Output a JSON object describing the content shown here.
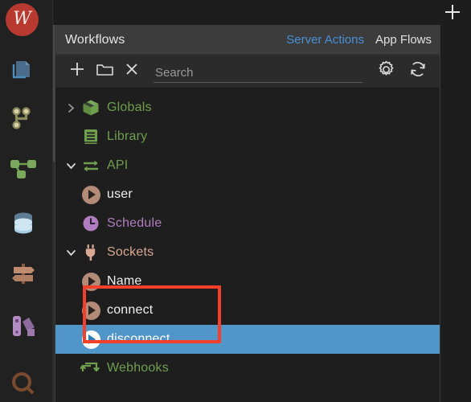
{
  "app": {
    "logo_letter": "W",
    "logo_color": "#b8392f",
    "background": "#1d1d1d"
  },
  "rail": {
    "items": [
      {
        "name": "pages-icon",
        "label": "Pages",
        "color": "#4b6b8a"
      },
      {
        "name": "git-branch-icon",
        "label": "Versions",
        "color": "#cfc79a"
      },
      {
        "name": "workflows-icon",
        "label": "Workflows",
        "color": "#7aa85c"
      },
      {
        "name": "database-icon",
        "label": "Database",
        "color": "#9fc4dd"
      },
      {
        "name": "signpost-icon",
        "label": "Routes",
        "color": "#b5816a"
      },
      {
        "name": "theme-icon",
        "label": "Theme",
        "color": "#9a76a8"
      },
      {
        "name": "search-rail-icon",
        "label": "Search",
        "color": "#7a4a2e"
      }
    ]
  },
  "titlebar": {
    "add_tab_icon": "plus-icon"
  },
  "panel": {
    "title": "Workflows",
    "tabs": [
      {
        "label": "Server Actions",
        "active": true,
        "color": "#4a90d9"
      },
      {
        "label": "App Flows",
        "active": false,
        "color": "#e0e0e0"
      }
    ]
  },
  "toolbar": {
    "add_label": "+",
    "add_icon": "plus-icon",
    "folder_icon": "folder-icon",
    "delete_icon": "close-x-icon",
    "settings_icon": "gear-icon",
    "refresh_icon": "refresh-icon"
  },
  "search": {
    "value": "",
    "placeholder": "Search"
  },
  "tree": {
    "nodes": [
      {
        "label": "Globals",
        "icon": "cube-icon",
        "color": "#6f9e4f",
        "twisty": "collapsed",
        "indent": 0,
        "selected": false
      },
      {
        "label": "Library",
        "icon": "book-icon",
        "color": "#6f9e4f",
        "twisty": "none",
        "indent": 0,
        "selected": false
      },
      {
        "label": "API",
        "icon": "exchange-icon",
        "color": "#6f9e4f",
        "twisty": "expanded",
        "indent": 0,
        "selected": false
      },
      {
        "label": "user",
        "icon": "play-circle-tan-icon",
        "color": "#f0f0f0",
        "twisty": "none",
        "indent": 1,
        "selected": false
      },
      {
        "label": "Schedule",
        "icon": "clock-icon",
        "color": "#b07ec0",
        "twisty": "none",
        "indent": 0,
        "selected": false
      },
      {
        "label": "Sockets",
        "icon": "plug-icon",
        "color": "#d8a895",
        "twisty": "expanded",
        "indent": 0,
        "selected": false
      },
      {
        "label": "Name",
        "icon": "play-circle-tan-icon",
        "color": "#f0f0f0",
        "twisty": "none",
        "indent": 1,
        "selected": false
      },
      {
        "label": "connect",
        "icon": "play-circle-tan-icon",
        "color": "#f0f0f0",
        "twisty": "none",
        "indent": 1,
        "selected": false
      },
      {
        "label": "disconnect",
        "icon": "play-circle-white-icon",
        "color": "#ffffff",
        "twisty": "none",
        "indent": 1,
        "selected": true
      },
      {
        "label": "Webhooks",
        "icon": "webhook-icon",
        "color": "#6f9e4f",
        "twisty": "none",
        "indent": 0,
        "selected": false
      }
    ]
  },
  "annotation": {
    "color": "#f4402a",
    "targets": "connect, disconnect"
  },
  "colors": {
    "selection": "#5196c8",
    "panel_bg": "#1e1e1e",
    "header_bg": "#3c3c3c",
    "toolbar_bg": "#2b2b2b",
    "link_blue": "#4a90d9"
  }
}
